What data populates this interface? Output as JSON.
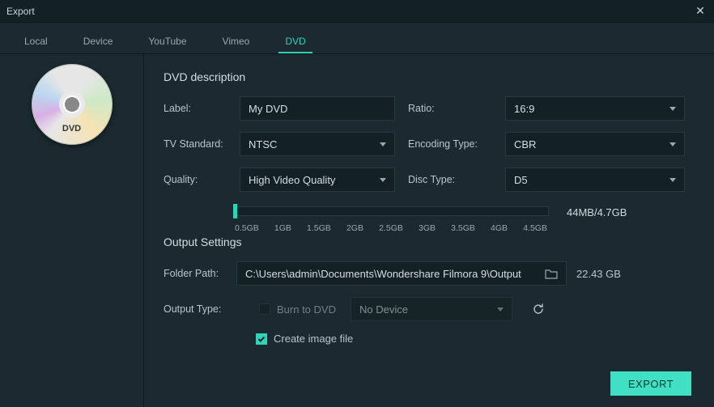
{
  "window": {
    "title": "Export"
  },
  "tabs": {
    "items": [
      {
        "label": "Local"
      },
      {
        "label": "Device"
      },
      {
        "label": "YouTube"
      },
      {
        "label": "Vimeo"
      },
      {
        "label": "DVD"
      }
    ],
    "active_index": 4
  },
  "sidebar": {
    "disc_label": "DVD"
  },
  "dvd": {
    "section_title": "DVD description",
    "labels": {
      "label": "Label:",
      "ratio": "Ratio:",
      "tv_standard": "TV Standard:",
      "encoding_type": "Encoding Type:",
      "quality": "Quality:",
      "disc_type": "Disc Type:"
    },
    "values": {
      "label": "My DVD",
      "ratio": "16:9",
      "tv_standard": "NTSC",
      "encoding_type": "CBR",
      "quality": "High Video Quality",
      "disc_type": "D5"
    },
    "slider_ticks": [
      "0.5GB",
      "1GB",
      "1.5GB",
      "2GB",
      "2.5GB",
      "3GB",
      "3.5GB",
      "4GB",
      "4.5GB"
    ],
    "size_readout": "44MB/4.7GB"
  },
  "output": {
    "section_title": "Output Settings",
    "labels": {
      "folder_path": "Folder Path:",
      "output_type": "Output Type:"
    },
    "folder_path": "C:\\Users\\admin\\Documents\\Wondershare Filmora 9\\Output",
    "free_space": "22.43 GB",
    "burn_to_dvd_label": "Burn to DVD",
    "burn_to_dvd_checked": false,
    "device_select": "No Device",
    "create_image_label": "Create image file",
    "create_image_checked": true
  },
  "buttons": {
    "export": "EXPORT"
  }
}
